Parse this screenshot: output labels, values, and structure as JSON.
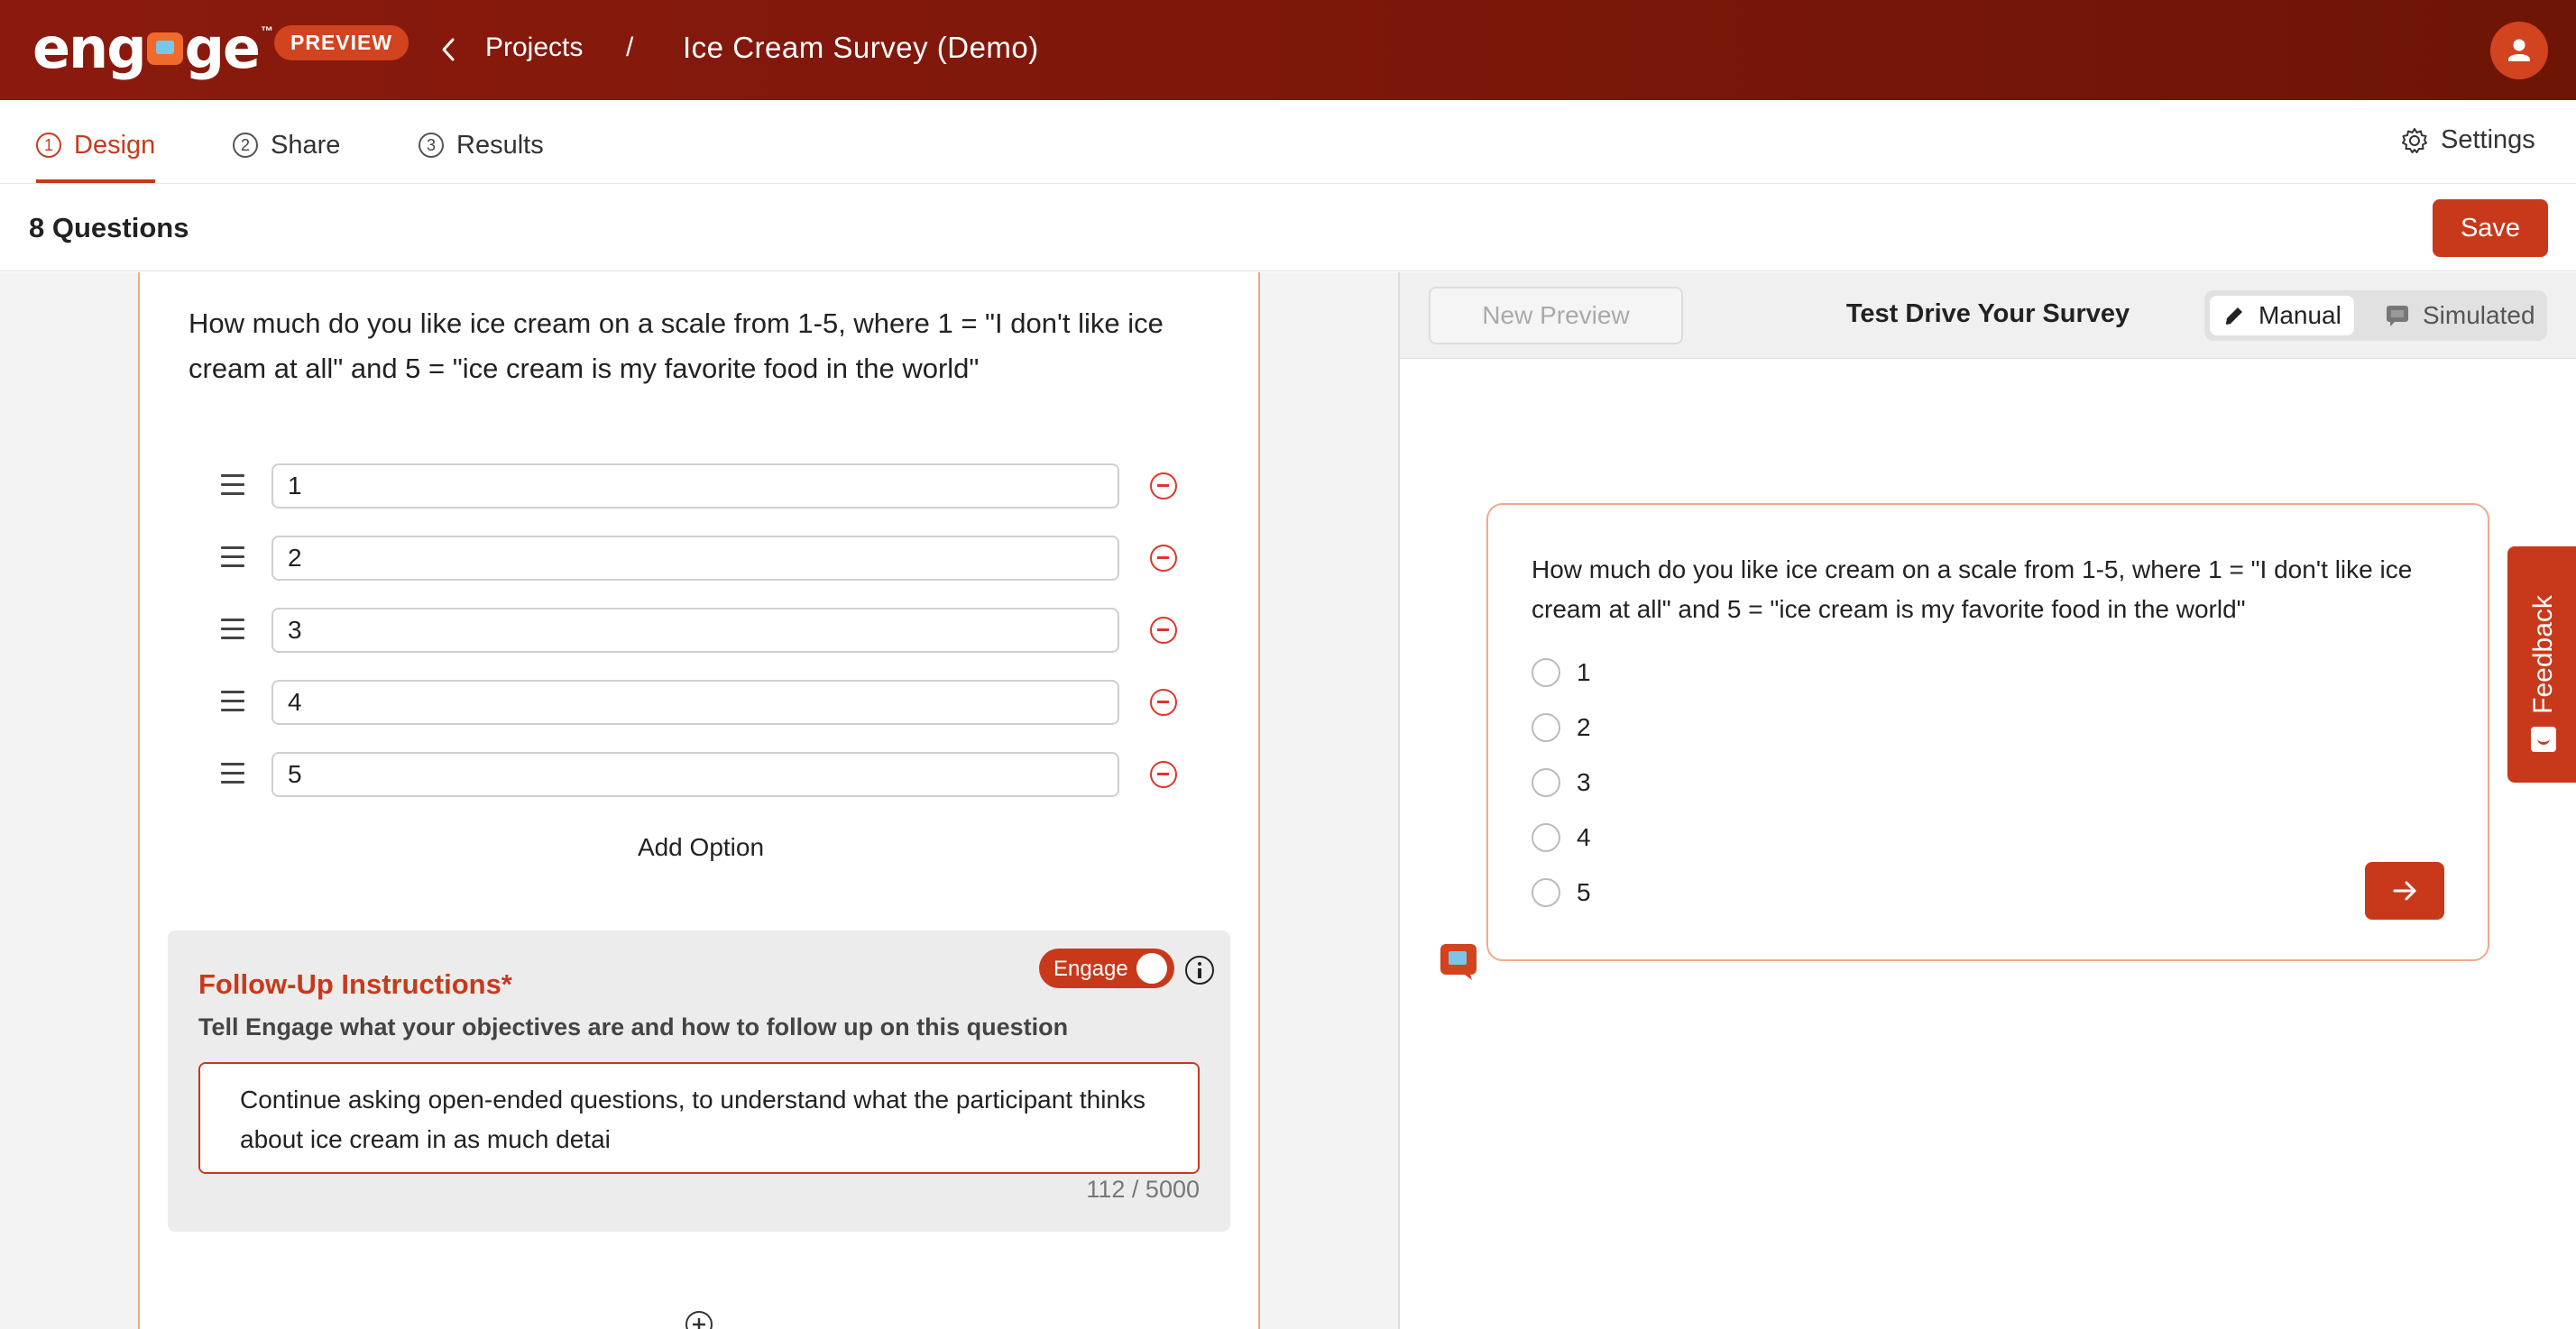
{
  "header": {
    "logo_text": "engage",
    "logo_tm": "™",
    "badge": "PREVIEW",
    "breadcrumb_projects": "Projects",
    "breadcrumb_separator": "/",
    "project_title": "Ice Cream Survey (Demo)"
  },
  "tabs": [
    {
      "num": "1",
      "label": "Design",
      "active": true
    },
    {
      "num": "2",
      "label": "Share",
      "active": false
    },
    {
      "num": "3",
      "label": "Results",
      "active": false
    }
  ],
  "settings_label": "Settings",
  "questions_count_label": "8 Questions",
  "save_label": "Save",
  "editor": {
    "question_text": "How much do you like ice cream on a scale from 1-5, where 1 = \"I don't like ice cream at all\" and 5 = \"ice cream is my favorite food in the world\"",
    "options": [
      "1",
      "2",
      "3",
      "4",
      "5"
    ],
    "add_option_label": "Add Option",
    "followup": {
      "title": "Follow-Up Instructions*",
      "subtitle": "Tell Engage what your objectives are and how to follow up on this question",
      "toggle_label": "Engage",
      "toggle_on": true,
      "instructions": "Continue asking open-ended questions, to understand what the participant thinks about ice cream in as much detai",
      "char_count": "112 / 5000"
    }
  },
  "preview": {
    "new_preview_label": "New Preview",
    "title": "Test Drive Your Survey",
    "mode_manual": "Manual",
    "mode_simulated": "Simulated",
    "active_mode": "Manual",
    "question_text": "How much do you like ice cream on a scale from 1-5, where 1 = \"I don't like ice cream at all\" and 5 = \"ice cream is my favorite food in the world\"",
    "choices": [
      "1",
      "2",
      "3",
      "4",
      "5"
    ]
  },
  "feedback_label": "Feedback",
  "colors": {
    "brand_dark": "#7a1a0c",
    "accent": "#c8391b",
    "accent_border": "#f0a98a"
  },
  "icons": [
    "chevron-left-icon",
    "user-icon",
    "gear-icon",
    "drag-handle-icon",
    "remove-circle-icon",
    "info-icon",
    "plus-circle-icon",
    "pencil-icon",
    "chat-icon",
    "arrow-right-icon",
    "smile-icon"
  ]
}
